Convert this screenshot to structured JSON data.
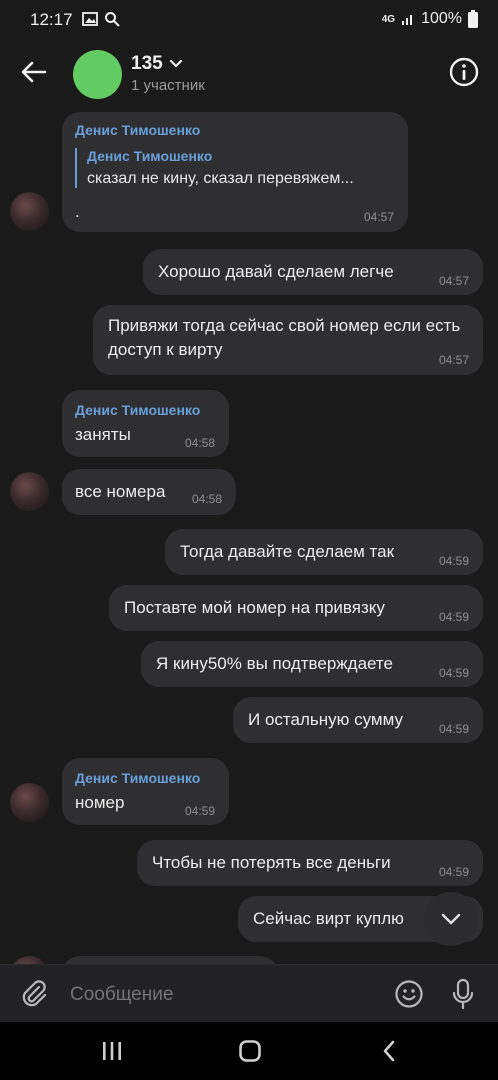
{
  "status": {
    "time": "12:17",
    "network": "4G",
    "battery": "100%"
  },
  "header": {
    "title": "135",
    "subtitle": "1 участник"
  },
  "messages": [
    {
      "sender": "Денис Тимошенко",
      "quote_name": "Денис Тимошенко",
      "quote_text": "сказал не кину, сказал перевяжем...",
      "text": ".",
      "time": "04:57"
    },
    {
      "text": "Хорошо давай сделаем легче",
      "time": "04:57"
    },
    {
      "text": "Привяжи тогда сейчас свой номер если есть доступ к вирту",
      "time": "04:57"
    },
    {
      "sender": "Денис Тимошенко",
      "text": "заняты",
      "time": "04:58"
    },
    {
      "text": "все номера",
      "time": "04:58"
    },
    {
      "text": "Тогда давайте сделаем так",
      "time": "04:59"
    },
    {
      "text": "Поставте мой номер на привязку",
      "time": "04:59"
    },
    {
      "text": "Я кину50% вы подтверждаете",
      "time": "04:59"
    },
    {
      "text": "И остальную сумму",
      "time": "04:59"
    },
    {
      "sender": "Денис Тимошенко",
      "text": "номер",
      "time": "04:59"
    },
    {
      "text": "Чтобы не потерять все деньги",
      "time": "04:59"
    },
    {
      "text": "Сейчас вирт куплю"
    }
  ],
  "composer": {
    "placeholder": "Сообщение"
  }
}
